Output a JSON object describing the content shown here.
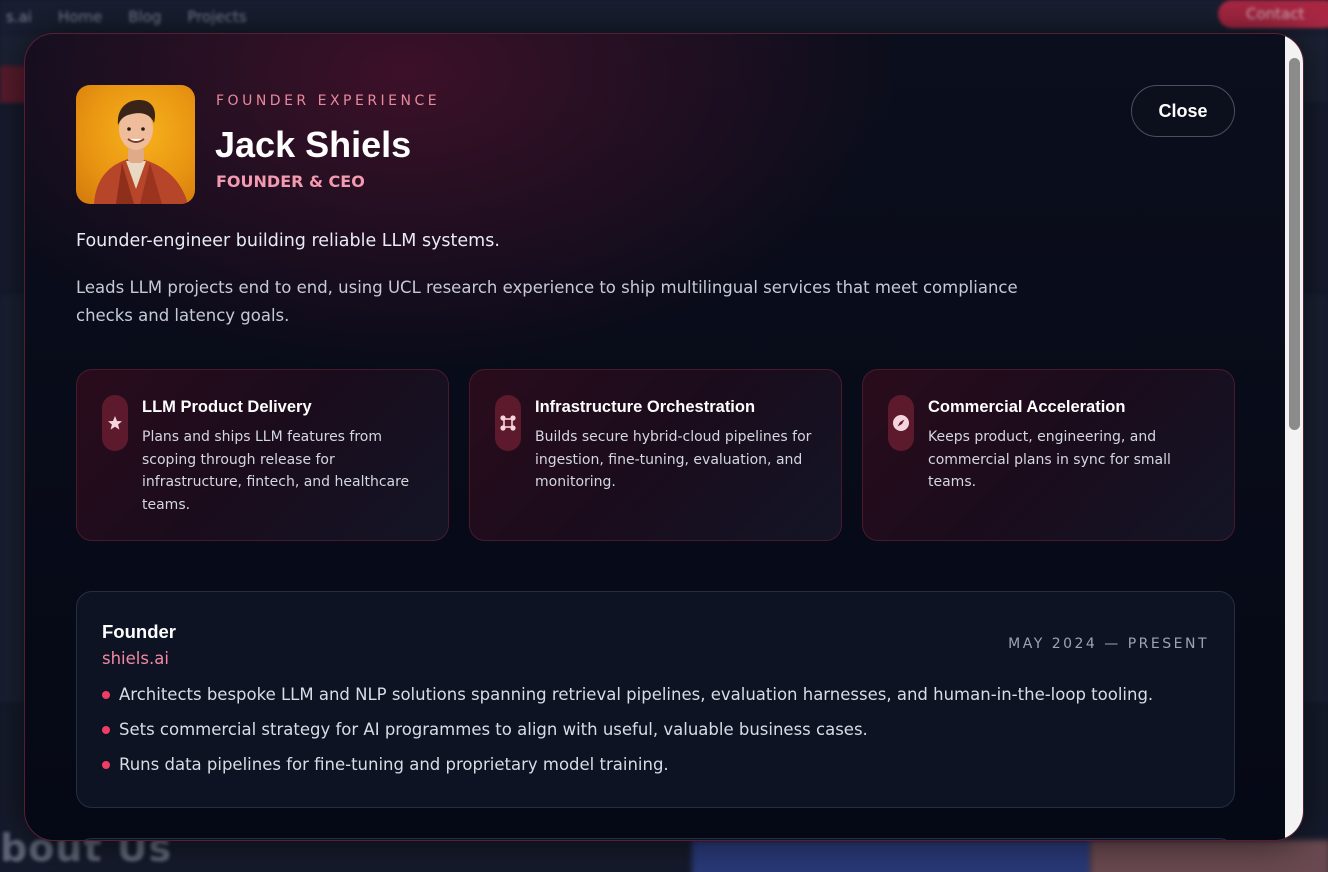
{
  "background_page": {
    "brand_fragment": "s.ai",
    "nav": [
      "Home",
      "Blog",
      "Projects"
    ],
    "cta_label": "Contact",
    "section_heading_fragment": "bout Us"
  },
  "modal": {
    "eyebrow": "FOUNDER EXPERIENCE",
    "name": "Jack Shiels",
    "role": "FOUNDER & CEO",
    "close_label": "Close",
    "tagline": "Founder-engineer building reliable LLM systems.",
    "summary": "Leads LLM projects end to end, using UCL research experience to ship multilingual services that meet compliance checks and latency goals.",
    "cards": [
      {
        "icon": "star-icon",
        "title": "LLM Product Delivery",
        "description": "Plans and ships LLM features from scoping through release for infrastructure, fintech, and healthcare teams."
      },
      {
        "icon": "nodes-icon",
        "title": "Infrastructure Orchestration",
        "description": "Builds secure hybrid-cloud pipelines for ingestion, fine-tuning, evaluation, and monitoring."
      },
      {
        "icon": "compass-icon",
        "title": "Commercial Acceleration",
        "description": "Keeps product, engineering, and commercial plans in sync for small teams."
      }
    ],
    "experience": {
      "title": "Founder",
      "company": "shiels.ai",
      "dates": "MAY 2024 — PRESENT",
      "bullets": [
        "Architects bespoke LLM and NLP solutions spanning retrieval pipelines, evaluation harnesses, and human-in-the-loop tooling.",
        "Sets commercial strategy for AI programmes to align with useful, valuable business cases.",
        "Runs data pipelines for fine-tuning and proprietary model training."
      ]
    }
  },
  "colors": {
    "accent_pink": "#f39ab0",
    "bullet_red": "#ef3d63",
    "modal_bg": "#050815",
    "avatar_bg": "#f0a315"
  }
}
